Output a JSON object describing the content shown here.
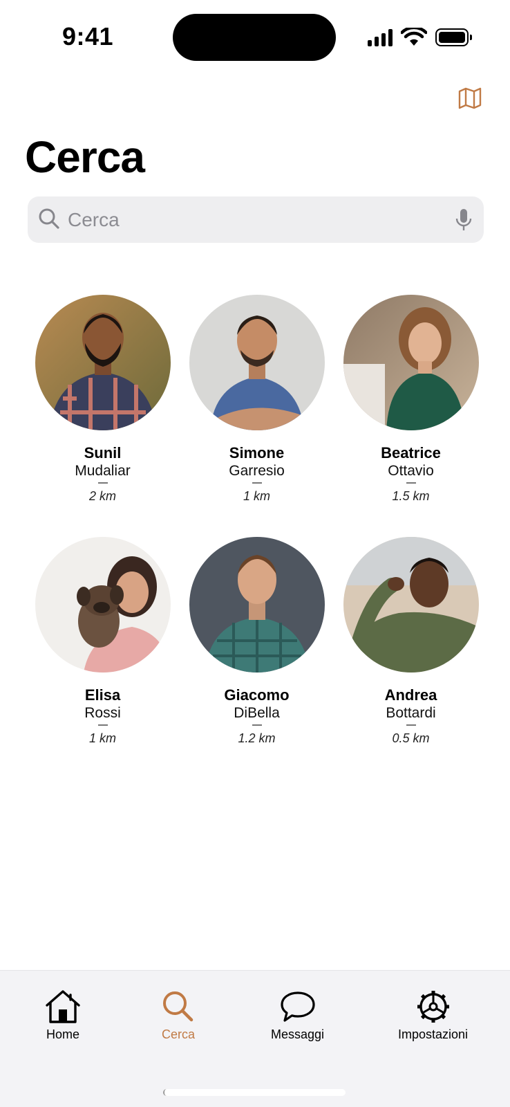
{
  "status_bar": {
    "time": "9:41"
  },
  "header": {
    "title": "Cerca",
    "map_icon": "map-icon"
  },
  "search": {
    "placeholder": "Cerca",
    "value": ""
  },
  "profiles": [
    {
      "first_name": "Sunil",
      "last_name": "Mudaliar",
      "distance": "2 km"
    },
    {
      "first_name": "Simone",
      "last_name": "Garresio",
      "distance": "1 km"
    },
    {
      "first_name": "Beatrice",
      "last_name": "Ottavio",
      "distance": "1.5 km"
    },
    {
      "first_name": "Elisa",
      "last_name": "Rossi",
      "distance": "1 km"
    },
    {
      "first_name": "Giacomo",
      "last_name": "DiBella",
      "distance": "1.2 km"
    },
    {
      "first_name": "Andrea",
      "last_name": "Bottardi",
      "distance": "0.5 km"
    }
  ],
  "tab_bar": {
    "tabs": [
      {
        "label": "Home",
        "icon": "house-icon"
      },
      {
        "label": "Cerca",
        "icon": "search-icon",
        "active": true
      },
      {
        "label": "Messaggi",
        "icon": "chat-bubble-icon"
      },
      {
        "label": "Impostazioni",
        "icon": "gear-icon"
      }
    ]
  },
  "colors": {
    "accent": "#c07a45",
    "search_bg": "#eeeef0",
    "tab_bar_bg": "#f3f3f6"
  }
}
